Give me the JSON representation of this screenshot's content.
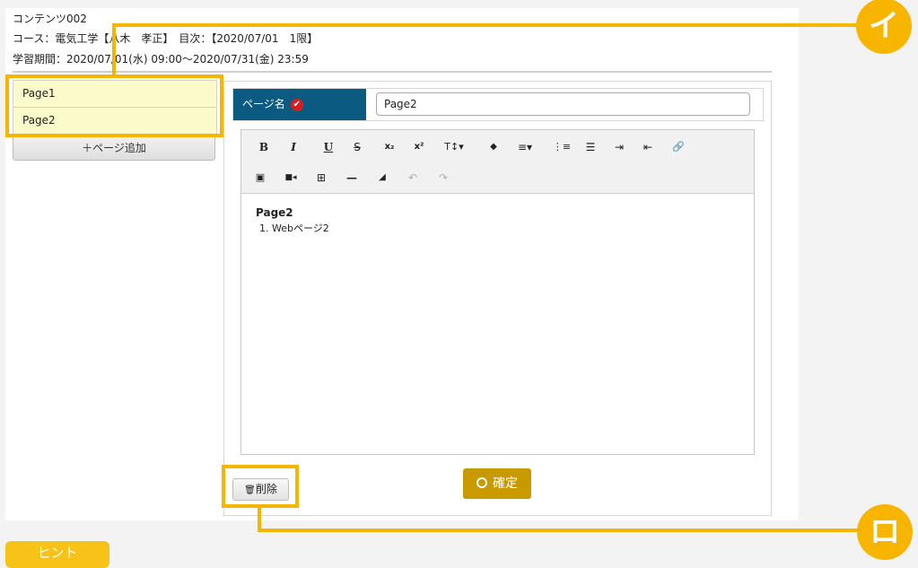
{
  "header": {
    "content_title": "コンテンツ002",
    "course_line": "コース：電気工学【八木　孝正】　目次：【2020/07/01　1限】",
    "period_line": "学習期間：2020/07/01(水) 09:00〜2020/07/31(金) 23:59"
  },
  "pages": [
    "Page1",
    "Page2"
  ],
  "add_page_label": "＋ページ追加",
  "page_name": {
    "label": "ページ名",
    "check_icon": "✔",
    "value": "Page2"
  },
  "toolbar": {
    "bold": "B",
    "italic": "I",
    "underline": "U",
    "strike": "S",
    "subscript": "x₂",
    "superscript": "x²",
    "font_size": "T↕▾",
    "color": "◆",
    "align": "≡▾",
    "ordered_list": "⋮≡",
    "unordered_list": "☰",
    "indent": "⇥",
    "outdent": "⇤",
    "link": "🔗",
    "image": "▣",
    "video": "■◂",
    "table": "⊞",
    "hr": "—",
    "eraser": "◢",
    "undo": "↶",
    "redo": "↷"
  },
  "content": {
    "heading": "Page2",
    "items": [
      "1. Webページ2"
    ]
  },
  "confirm_label": "確定",
  "delete_label": "削除",
  "delete_icon": "🗑",
  "annotations": {
    "callout_a": "イ",
    "callout_b": "ロ",
    "hint": "ヒント",
    "color": "#f7b500"
  }
}
